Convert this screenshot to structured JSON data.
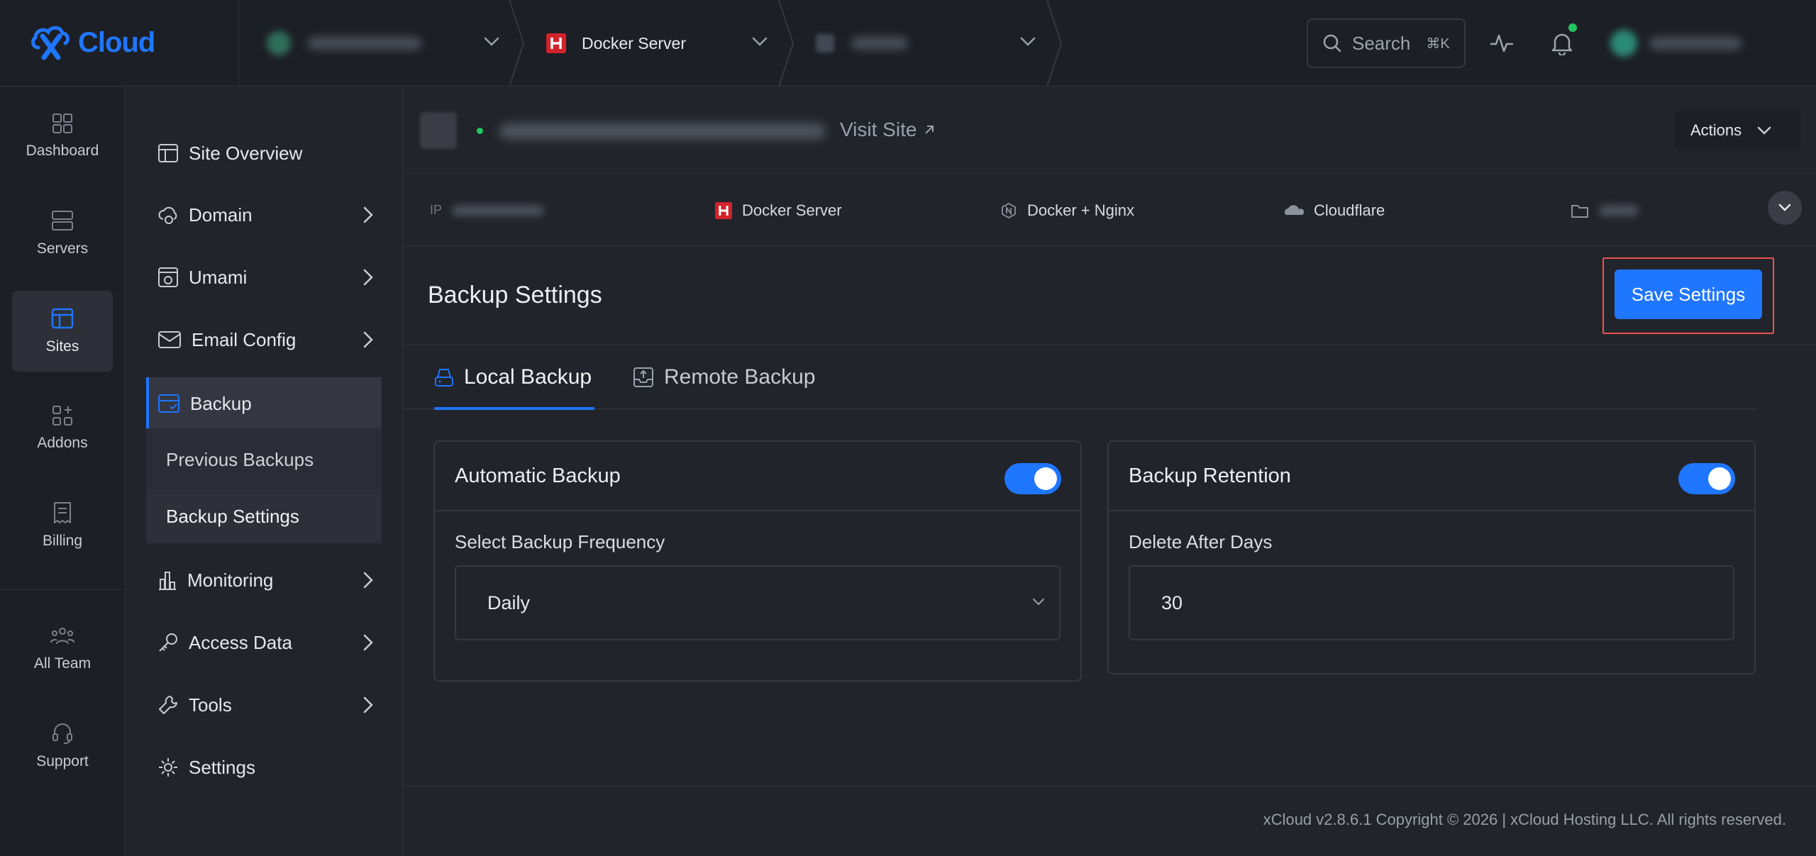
{
  "brand": {
    "name": "Cloud",
    "accent": "#1f76ff"
  },
  "topbar": {
    "crumbs": [
      {
        "label": "",
        "icon": "server-avatar-icon",
        "blurred": true
      },
      {
        "label": "Docker Server",
        "icon": "docker-server-h-icon",
        "blurred": false
      },
      {
        "label": "",
        "icon": "site-icon",
        "blurred": true
      }
    ],
    "search": {
      "label": "Search",
      "shortcut": "⌘K"
    },
    "icons": [
      "activity-icon",
      "bell-icon",
      "user-avatar-icon"
    ]
  },
  "rail": {
    "items": [
      {
        "label": "Dashboard",
        "icon": "dashboard-icon"
      },
      {
        "label": "Servers",
        "icon": "servers-icon"
      },
      {
        "label": "Sites",
        "icon": "sites-icon",
        "active": true
      },
      {
        "label": "Addons",
        "icon": "addons-icon"
      },
      {
        "label": "Billing",
        "icon": "billing-icon"
      },
      {
        "label": "All Team",
        "icon": "team-icon"
      },
      {
        "label": "Support",
        "icon": "headset-icon"
      }
    ]
  },
  "sidebar": {
    "items": [
      {
        "label": "Site Overview",
        "icon": "overview-icon"
      },
      {
        "label": "Domain",
        "icon": "cloud-globe-icon"
      },
      {
        "label": "Umami",
        "icon": "umami-icon"
      },
      {
        "label": "Email Config",
        "icon": "mail-icon"
      },
      {
        "label": "Backup",
        "icon": "backup-icon",
        "active": true
      },
      {
        "label": "Monitoring",
        "icon": "chart-bars-icon"
      },
      {
        "label": "Access Data",
        "icon": "key-icon"
      },
      {
        "label": "Tools",
        "icon": "wrench-icon"
      },
      {
        "label": "Settings",
        "icon": "gear-icon"
      }
    ],
    "backup_sub": [
      {
        "label": "Previous Backups"
      },
      {
        "label": "Backup Settings",
        "active": true
      }
    ]
  },
  "site": {
    "visit_label": "Visit Site",
    "actions_label": "Actions",
    "info": {
      "ip_label": "IP",
      "server": "Docker Server",
      "stack": "Docker + Nginx",
      "dns": "Cloudflare"
    }
  },
  "backup": {
    "title": "Backup Settings",
    "save_label": "Save Settings",
    "tabs": [
      {
        "label": "Local Backup",
        "active": true
      },
      {
        "label": "Remote Backup"
      }
    ],
    "automatic": {
      "title": "Automatic Backup",
      "enabled": true,
      "field_label": "Select Backup Frequency",
      "frequency": "Daily"
    },
    "retention": {
      "title": "Backup Retention",
      "enabled": true,
      "field_label": "Delete After Days",
      "days": "30"
    }
  },
  "footer": {
    "text": "xCloud v2.8.6.1 Copyright © 2026 | xCloud Hosting LLC. All rights reserved."
  },
  "colors": {
    "accent": "#1f76ff",
    "success": "#22c55e",
    "highlight": "#e8524a",
    "docker_red": "#d3222a"
  }
}
